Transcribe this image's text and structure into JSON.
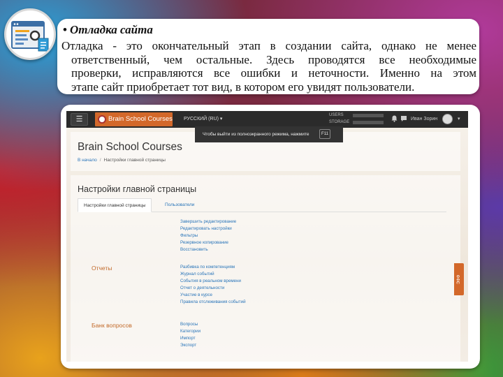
{
  "slide": {
    "heading": "Отладка сайта",
    "bullet": "•",
    "body_lines": [
      "Отладка - это окончательный этап в создании сайта, однако не менее",
      "ответственный, чем остальные. Здесь проводятся все необходимые",
      "проверки, исправляются все ошибки и неточности. Именно на этом",
      "этапе сайт приобретает тот вид, в котором его увидят пользователи."
    ]
  },
  "navbar": {
    "menu_icon": "☰",
    "brand": "Brain School Courses",
    "language": "РУССКИЙ (RU)",
    "language_caret": "▾",
    "stat_users": "USERS",
    "stat_storage": "STORAGE",
    "bell_icon": "bell-icon",
    "chat_icon": "chat-icon",
    "username": "Иван Зорин",
    "avatar_caret": "▾"
  },
  "fullscreen_tooltip": {
    "text": "Чтобы выйти из полноэкранного режима, нажмите",
    "key": "F11"
  },
  "header": {
    "site_title": "Brain School Courses",
    "breadcrumb": {
      "home": "В начало",
      "separator": "/",
      "current": "Настройки главной страницы"
    }
  },
  "main": {
    "page_title": "Настройки главной страницы",
    "tabs": [
      {
        "label": "Настройки главной страницы",
        "active": true
      },
      {
        "label": "Пользователи",
        "active": false
      }
    ],
    "general_links": [
      "Завершить редактирование",
      "Редактировать настройки",
      "Фильтры",
      "Резервное копирование",
      "Восстановить"
    ],
    "sections": [
      {
        "title": "Отчеты",
        "links": [
          "Разбивка по компетенциям",
          "Журнал событий",
          "События в реальном времени",
          "Отчет о деятельности",
          "Участие в курсе",
          "Правила отслеживания событий"
        ]
      },
      {
        "title": "Банк вопросов",
        "links": [
          "Вопросы",
          "Категории",
          "Импорт",
          "Экспорт"
        ]
      }
    ],
    "side_tab": "ЭФФ"
  },
  "colors": {
    "accent": "#d3682a",
    "link": "#2a75b9",
    "navbar": "#2b2b2b"
  }
}
